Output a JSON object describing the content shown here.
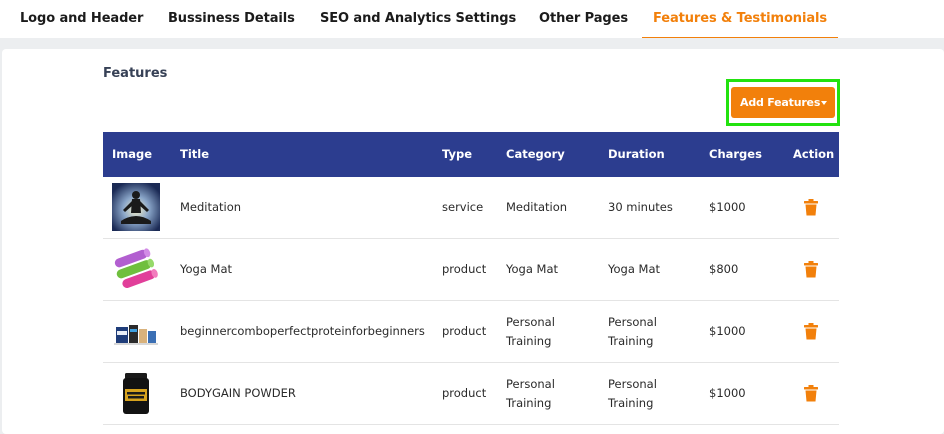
{
  "tabs": [
    {
      "label": "Logo and Header"
    },
    {
      "label": "Bussiness Details"
    },
    {
      "label": "SEO and Analytics Settings"
    },
    {
      "label": "Other Pages"
    },
    {
      "label": "Features & Testimonials"
    }
  ],
  "active_tab": "Features & Testimonials",
  "section": {
    "title": "Features"
  },
  "add_button": {
    "label": "Add Features"
  },
  "table": {
    "columns": [
      "Image",
      "Title",
      "Type",
      "Category",
      "Duration",
      "Charges",
      "Action"
    ],
    "rows": [
      {
        "title": "Meditation",
        "type": "service",
        "category": "Meditation",
        "duration": "30 minutes",
        "charges": "$1000",
        "image_icon": "meditation-silhouette"
      },
      {
        "title": "Yoga Mat",
        "type": "product",
        "category": "Yoga Mat",
        "duration": "Yoga Mat",
        "charges": "$800",
        "image_icon": "yoga-mat-rolls"
      },
      {
        "title": "beginnercomboperfectproteinforbeginners",
        "type": "product",
        "category": "Personal Training",
        "duration": "Personal Training",
        "charges": "$1000",
        "image_icon": "protein-combo"
      },
      {
        "title": "BODYGAIN POWDER",
        "type": "product",
        "category": "Personal Training",
        "duration": "Personal Training",
        "charges": "$1000",
        "image_icon": "gainer-jar"
      }
    ]
  },
  "colors": {
    "accent": "#f2800b",
    "table_header": "#2c3d8f",
    "highlight": "#22e20f"
  }
}
